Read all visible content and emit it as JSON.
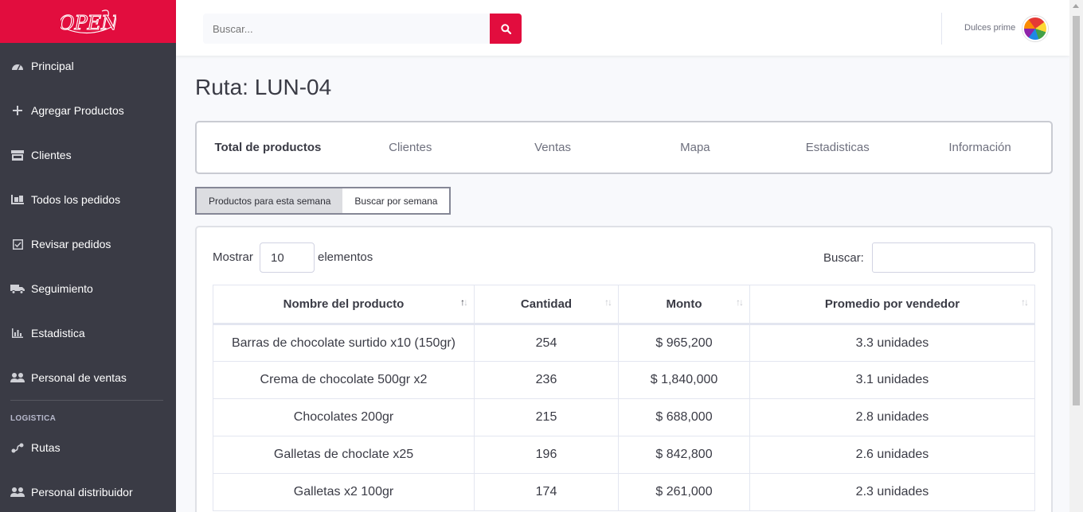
{
  "brand": {
    "logo_text": "OPEN",
    "color": "#e20d3e"
  },
  "sidebar": {
    "items": [
      {
        "label": "Principal",
        "icon": "dashboard-icon"
      },
      {
        "label": "Agregar Productos",
        "icon": "plus-icon"
      },
      {
        "label": "Clientes",
        "icon": "store-icon"
      },
      {
        "label": "Todos los pedidos",
        "icon": "pallet-icon"
      },
      {
        "label": "Revisar pedidos",
        "icon": "check-square-icon"
      },
      {
        "label": "Seguimiento",
        "icon": "truck-icon"
      },
      {
        "label": "Estadistica",
        "icon": "chart-icon"
      },
      {
        "label": "Personal de ventas",
        "icon": "users-icon"
      }
    ],
    "heading": "LOGISTICA",
    "logistics_items": [
      {
        "label": "Rutas",
        "icon": "route-icon"
      },
      {
        "label": "Personal distribuidor",
        "icon": "users-icon"
      }
    ]
  },
  "topbar": {
    "search_placeholder": "Buscar...",
    "user_name": "Dulces prime"
  },
  "page": {
    "title": "Ruta: LUN-04",
    "tabs": [
      "Total de productos",
      "Clientes",
      "Ventas",
      "Mapa",
      "Estadisticas",
      "Información"
    ],
    "active_tab": 0,
    "week_buttons": [
      "Productos para esta semana",
      "Buscar por semana"
    ]
  },
  "table_controls": {
    "show_label": "Mostrar",
    "show_value": "10",
    "show_suffix": "elementos",
    "search_label": "Buscar:"
  },
  "table": {
    "columns": [
      "Nombre del producto",
      "Cantidad",
      "Monto",
      "Promedio por vendedor"
    ],
    "rows": [
      [
        "Barras de chocolate surtido x10 (150gr)",
        "254",
        "$ 965,200",
        "3.3 unidades"
      ],
      [
        "Crema de chocolate 500gr x2",
        "236",
        "$ 1,840,000",
        "3.1 unidades"
      ],
      [
        "Chocolates 200gr",
        "215",
        "$ 688,000",
        "2.8 unidades"
      ],
      [
        "Galletas de choclate x25",
        "196",
        "$ 842,800",
        "2.6 unidades"
      ],
      [
        "Galletas x2 100gr",
        "174",
        "$ 261,000",
        "2.3 unidades"
      ]
    ]
  }
}
